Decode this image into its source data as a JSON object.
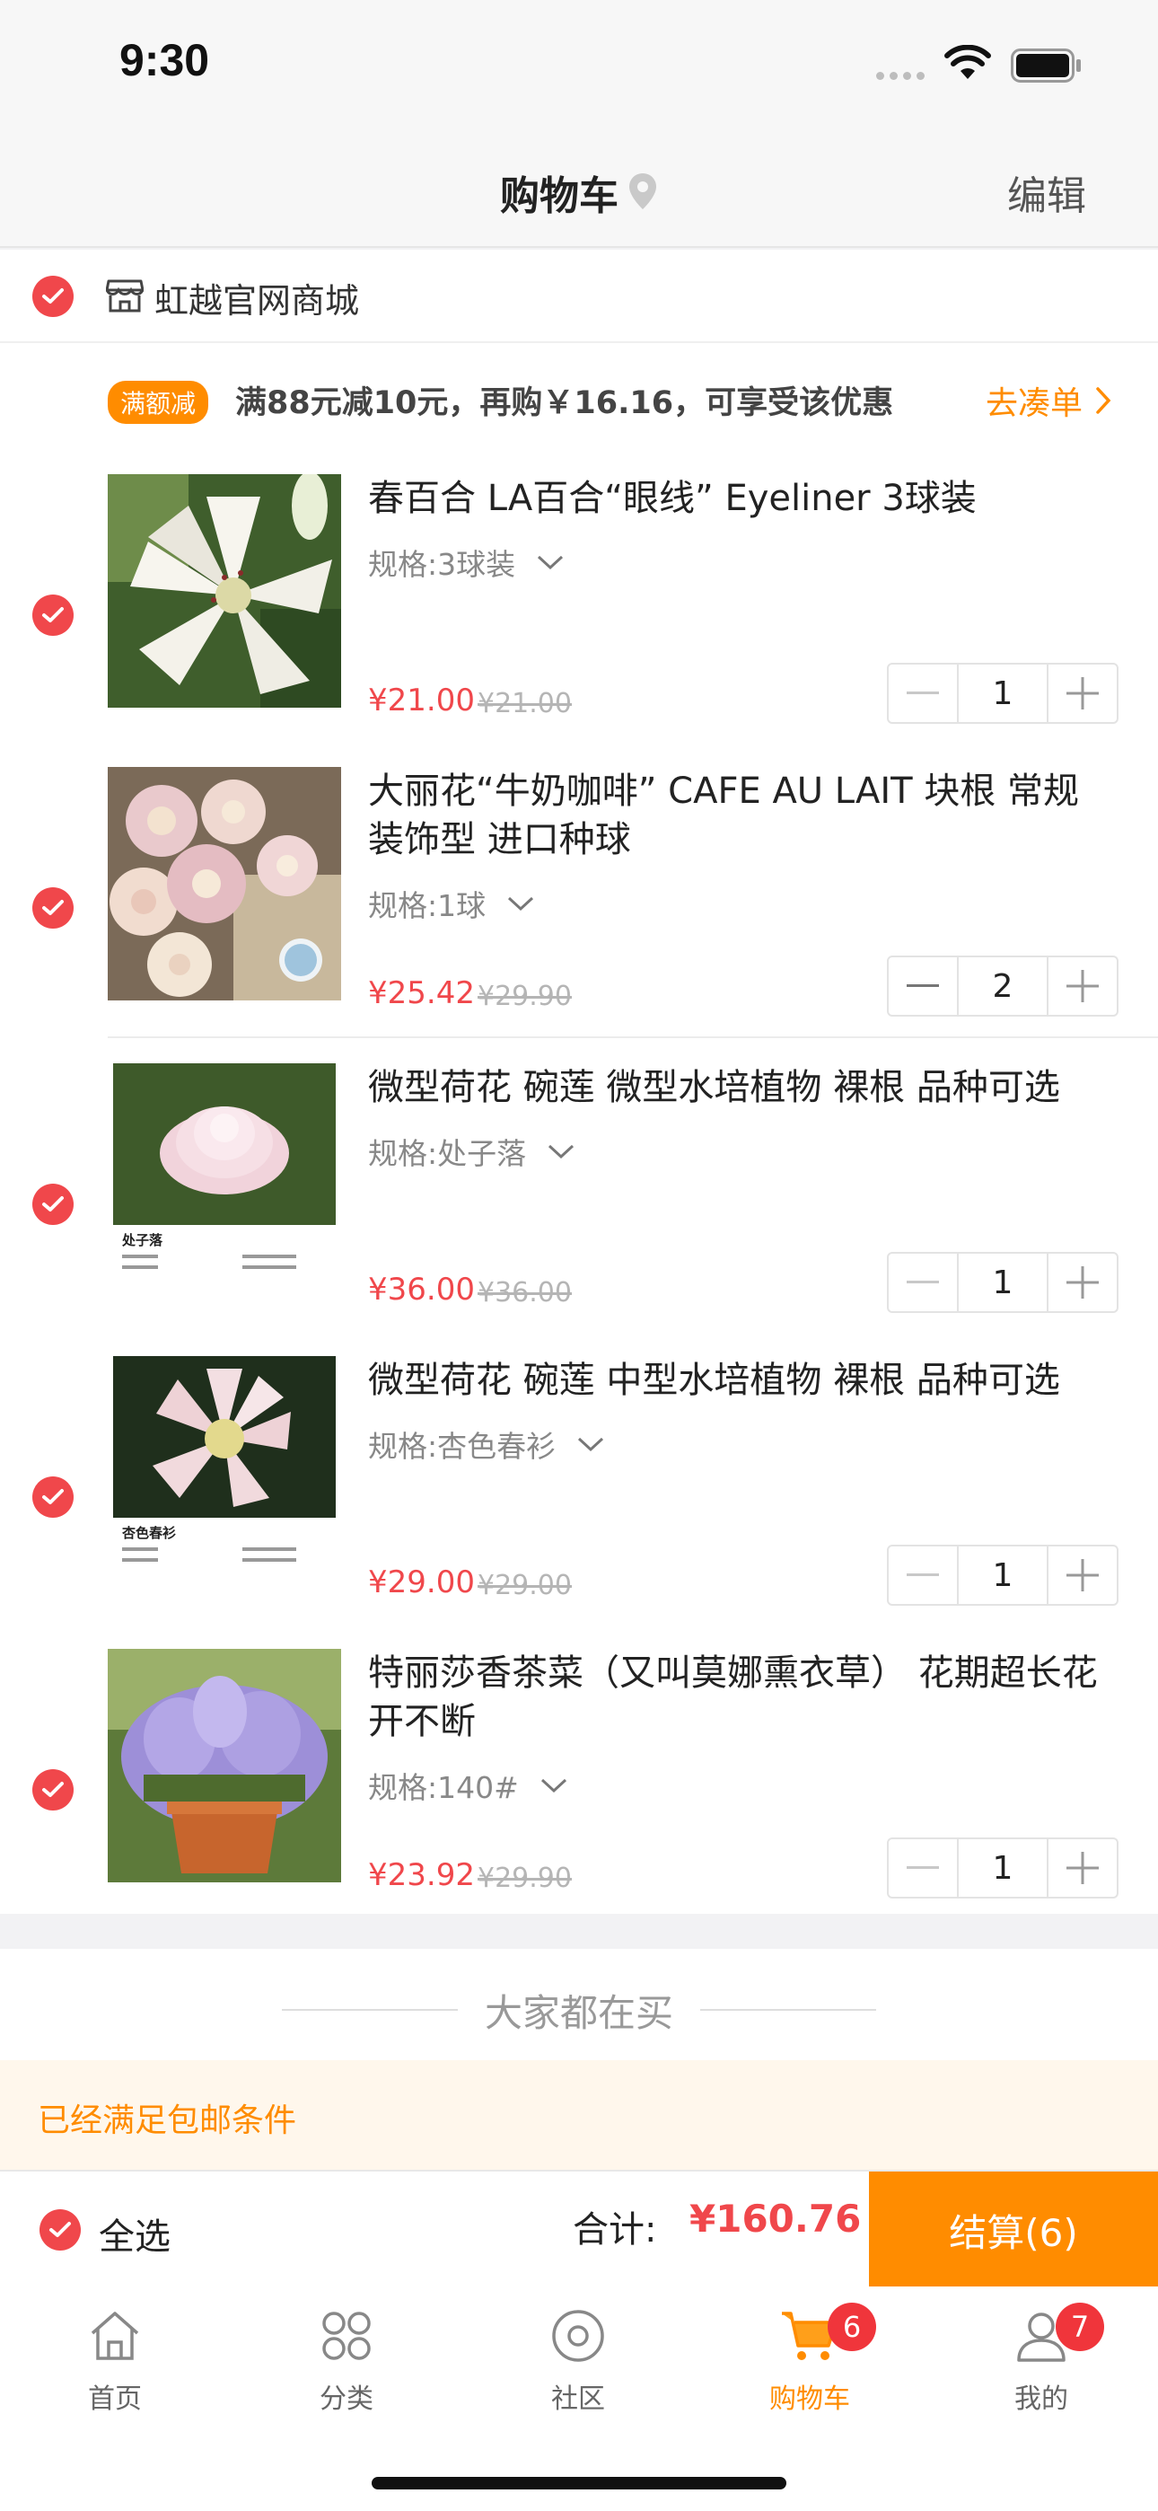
{
  "status_bar": {
    "time": "9:30"
  },
  "nav": {
    "title": "购物车",
    "edit_label": "编辑"
  },
  "store": {
    "name": "虹越官网商城"
  },
  "promo": {
    "tag": "满额减",
    "text": "满88元减10元，再购￥16.16，可享受该优惠",
    "link_label": "去凑单"
  },
  "items": [
    {
      "title": "春百合 LA百合“眼线” Eyeliner 3球装",
      "spec": "规格:3球装",
      "price": "¥21.00",
      "original_price": "¥21.00",
      "quantity": "1"
    },
    {
      "title": "大丽花“牛奶咖啡” CAFE AU LAIT 块根 常规装饰型 进口种球",
      "spec": "规格:1球",
      "price": "¥25.42",
      "original_price": "¥29.90",
      "quantity": "2"
    },
    {
      "title": "微型荷花 碗莲 微型水培植物 裸根 品种可选",
      "spec": "规格:处子落",
      "price": "¥36.00",
      "original_price": "¥36.00",
      "quantity": "1",
      "image_caption": "处子落"
    },
    {
      "title": "微型荷花 碗莲 中型水培植物 裸根 品种可选",
      "spec": "规格:杏色春衫",
      "price": "¥29.00",
      "original_price": "¥29.00",
      "quantity": "1",
      "image_caption": "杏色春衫"
    },
    {
      "title": "特丽莎香茶菜（又叫莫娜熏衣草） 花期超长花开不断",
      "spec": "规格:140#",
      "price": "¥23.92",
      "original_price": "¥29.90",
      "quantity": "1"
    }
  ],
  "recommendation": {
    "title": "大家都在买"
  },
  "free_shipping": {
    "text": "已经满足包邮条件"
  },
  "checkout": {
    "select_all_label": "全选",
    "total_label": "合计:",
    "total_amount": "¥160.76",
    "button_label": "结算(6)"
  },
  "tabs": [
    {
      "label": "首页",
      "icon": "home-icon"
    },
    {
      "label": "分类",
      "icon": "category-icon"
    },
    {
      "label": "社区",
      "icon": "community-icon"
    },
    {
      "label": "购物车",
      "icon": "cart-icon",
      "badge": "6",
      "active": true
    },
    {
      "label": "我的",
      "icon": "user-icon",
      "badge": "7"
    }
  ],
  "colors": {
    "accent": "#ff8c00",
    "price_red": "#f0474b",
    "badge_red": "#f0353b"
  }
}
